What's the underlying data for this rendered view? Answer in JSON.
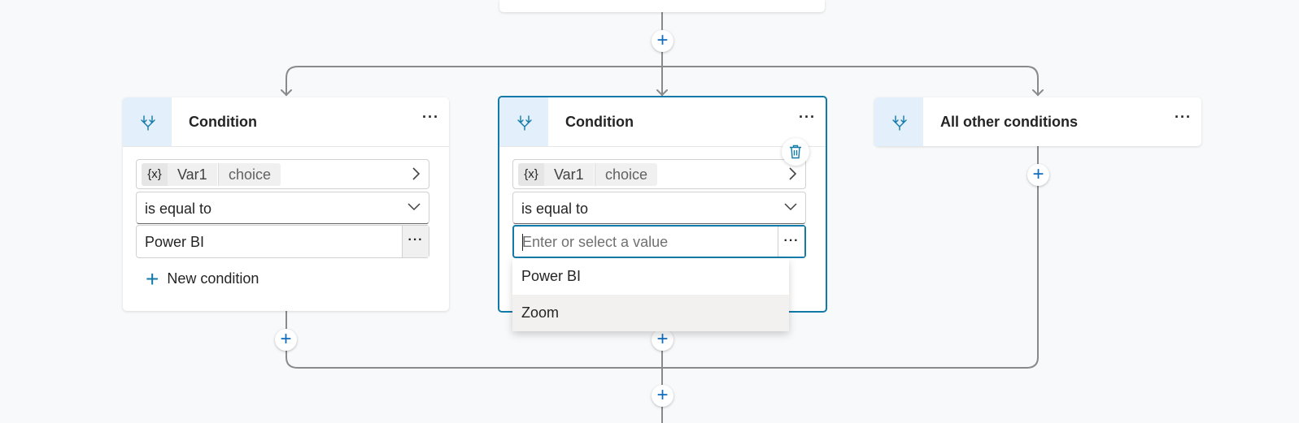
{
  "branches": [
    {
      "title": "Condition",
      "variable": {
        "icon": "{x}",
        "name": "Var1",
        "type": "choice"
      },
      "operator": "is equal to",
      "value": "Power BI",
      "new_condition_label": "New condition"
    },
    {
      "title": "Condition",
      "variable": {
        "icon": "{x}",
        "name": "Var1",
        "type": "choice"
      },
      "operator": "is equal to",
      "value_placeholder": "Enter or select a value",
      "dropdown_options": [
        "Power BI",
        "Zoom"
      ]
    },
    {
      "title": "All other conditions"
    }
  ],
  "more_glyph": "···",
  "add_glyph": "+",
  "colors": {
    "accent": "#117aa8",
    "icon_bg": "#e3effb",
    "connector": "#8a8a8a"
  },
  "icons": [
    "branch-icon",
    "more-icon",
    "delete-icon",
    "chevron-right-icon",
    "chevron-down-icon",
    "add-icon"
  ]
}
